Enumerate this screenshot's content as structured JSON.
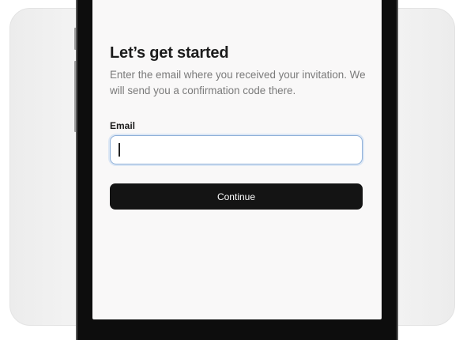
{
  "screen": {
    "title": "Let’s get started",
    "subtitle": "Enter the email where you received your invitation. We will send you a confirmation code there.",
    "email_label": "Email",
    "email_value": "",
    "email_placeholder": "",
    "continue_label": "Continue"
  },
  "colors": {
    "button_bg": "#141414",
    "input_focus_border": "#8fb0d8",
    "screen_bg": "#f9f8f8"
  }
}
